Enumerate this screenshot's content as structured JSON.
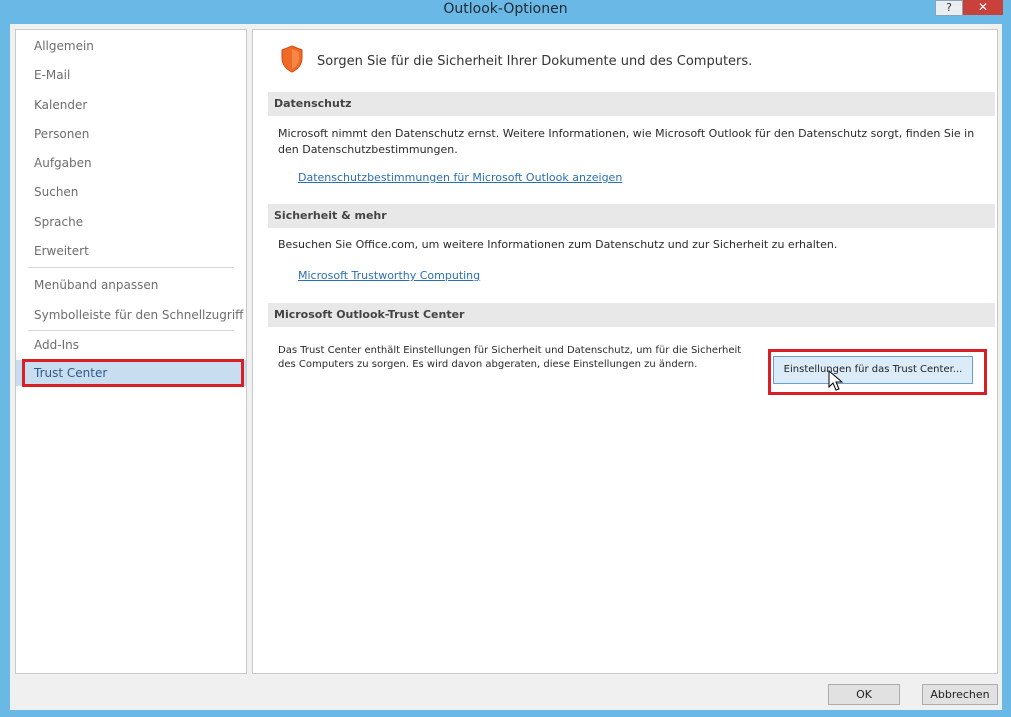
{
  "window": {
    "title": "Outlook-Optionen",
    "help_label": "?",
    "close_label": "✕"
  },
  "sidebar": {
    "items": [
      {
        "label": "Allgemein"
      },
      {
        "label": "E-Mail"
      },
      {
        "label": "Kalender"
      },
      {
        "label": "Personen"
      },
      {
        "label": "Aufgaben"
      },
      {
        "label": "Suchen"
      },
      {
        "label": "Sprache"
      },
      {
        "label": "Erweitert"
      },
      {
        "label": "Menüband anpassen"
      },
      {
        "label": "Symbolleiste für den Schnellzugriff"
      },
      {
        "label": "Add-Ins"
      },
      {
        "label": "Trust Center",
        "selected": true
      }
    ]
  },
  "main": {
    "intro": "Sorgen Sie für die Sicherheit Ihrer Dokumente und des Computers.",
    "sections": [
      {
        "header": "Datenschutz",
        "text": "Microsoft nimmt den Datenschutz ernst. Weitere Informationen, wie Microsoft Outlook für den Datenschutz sorgt, finden Sie in den Datenschutzbestimmungen.",
        "link": "Datenschutzbestimmungen für Microsoft Outlook anzeigen"
      },
      {
        "header": "Sicherheit & mehr",
        "text": "Besuchen Sie Office.com, um weitere Informationen zum Datenschutz und zur Sicherheit zu erhalten.",
        "link": "Microsoft Trustworthy Computing"
      },
      {
        "header": "Microsoft Outlook-Trust Center",
        "text": "Das Trust Center enthält Einstellungen für Sicherheit und Datenschutz, um für die Sicherheit des Computers zu sorgen. Es wird davon abgeraten, diese Einstellungen zu ändern.",
        "button": "Einstellungen für das Trust Center..."
      }
    ]
  },
  "footer": {
    "ok_label": "OK",
    "cancel_label": "Abbrechen"
  },
  "colors": {
    "highlight": "#d81f26",
    "titlebar": "#6ab8e6",
    "selection": "#c8def0",
    "link": "#2a6fb5"
  }
}
